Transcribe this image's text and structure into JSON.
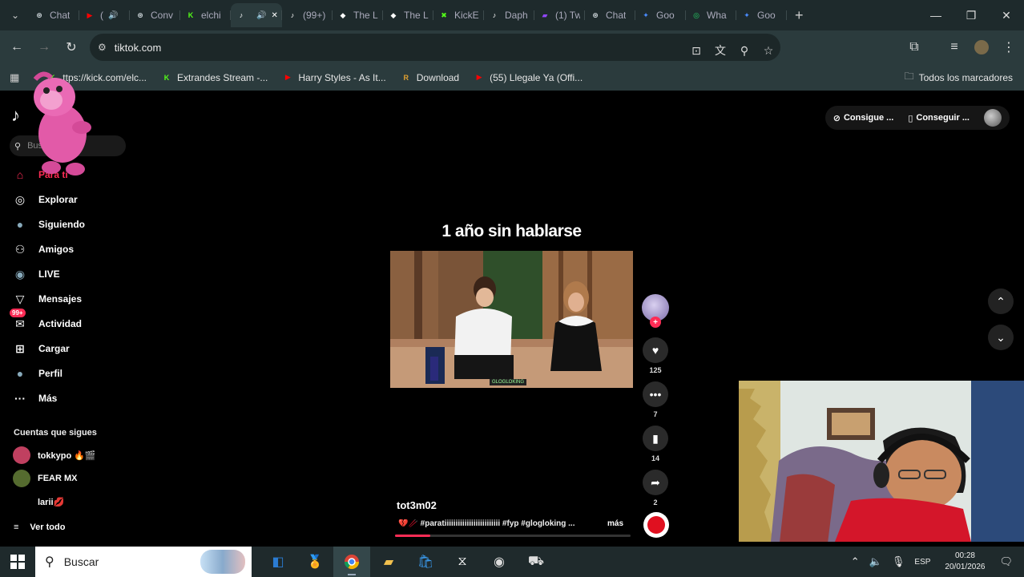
{
  "tabs": [
    {
      "label": "Chat",
      "icon": "chatgpt-icon",
      "color": "#cfd8dc",
      "active": false
    },
    {
      "label": "(",
      "icon": "youtube-icon",
      "color": "#ff0000",
      "active": false,
      "audio": true
    },
    {
      "label": "Conv",
      "icon": "chatgpt-icon",
      "color": "#cfd8dc",
      "active": false
    },
    {
      "label": "elchi",
      "icon": "kick-icon",
      "color": "#53fc18",
      "active": false
    },
    {
      "label": "",
      "icon": "tiktok-icon",
      "color": "#ffffff",
      "active": true,
      "audio": true
    },
    {
      "label": "(99+)",
      "icon": "tiktok-icon",
      "color": "#ffffff",
      "active": false
    },
    {
      "label": "The L",
      "icon": "diamond-icon",
      "color": "#ffffff",
      "active": false
    },
    {
      "label": "The L",
      "icon": "diamond-icon",
      "color": "#ffffff",
      "active": false
    },
    {
      "label": "KickE",
      "icon": "kick-green-icon",
      "color": "#53fc18",
      "active": false
    },
    {
      "label": "Daph",
      "icon": "tiktok-icon",
      "color": "#ffffff",
      "active": false
    },
    {
      "label": "(1) Tw",
      "icon": "twitch-icon",
      "color": "#9146ff",
      "active": false
    },
    {
      "label": "Chat",
      "icon": "chatgpt-icon",
      "color": "#cfd8dc",
      "active": false
    },
    {
      "label": "Goo",
      "icon": "gemini-icon",
      "color": "#4a8cff",
      "active": false
    },
    {
      "label": "Wha",
      "icon": "whatsapp-icon",
      "color": "#25d366",
      "active": false
    },
    {
      "label": "Goo",
      "icon": "gemini-icon",
      "color": "#4a8cff",
      "active": false
    }
  ],
  "address": {
    "url": "tiktok.com"
  },
  "bookmarks": [
    {
      "label": "ttps://kick.com/elc...",
      "icon": "kick-icon",
      "color": "#53fc18"
    },
    {
      "label": "Extrandes Stream -...",
      "icon": "kick-icon",
      "color": "#53fc18"
    },
    {
      "label": "Harry Styles - As It...",
      "icon": "youtube-icon",
      "color": "#ff0000"
    },
    {
      "label": "Download",
      "icon": "r-icon",
      "color": "#e0a030"
    },
    {
      "label": "(55) Llegale Ya (Offi...",
      "icon": "youtube-icon",
      "color": "#ff0000"
    }
  ],
  "bookmarks_all": "Todos los marcadores",
  "sidebar": {
    "search_placeholder": "Bus",
    "nav": [
      {
        "label": "Para ti",
        "icon": "home-icon",
        "active": true
      },
      {
        "label": "Explorar",
        "icon": "compass-icon"
      },
      {
        "label": "Siguiendo",
        "icon": "following-icon"
      },
      {
        "label": "Amigos",
        "icon": "friends-icon"
      },
      {
        "label": "LIVE",
        "icon": "live-icon"
      },
      {
        "label": "Mensajes",
        "icon": "messages-icon"
      },
      {
        "label": "Actividad",
        "icon": "activity-icon",
        "badge": "99+"
      },
      {
        "label": "Cargar",
        "icon": "upload-icon"
      },
      {
        "label": "Perfil",
        "icon": "profile-icon"
      },
      {
        "label": "Más",
        "icon": "more-icon"
      }
    ],
    "following_title": "Cuentas que sigues",
    "following": [
      {
        "name": "tokkypo 🔥🎬",
        "color": "#c04060"
      },
      {
        "name": "FEAR MX",
        "color": "#556b2f"
      },
      {
        "name": "larii💋",
        "color": "#000000"
      }
    ],
    "see_all": "Ver todo"
  },
  "top_right": {
    "coins": "Consigue ...",
    "app": "Conseguir ..."
  },
  "video": {
    "title": "1 año sin hablarse",
    "watermark": "GLOGLOKING",
    "author": "tot3m02",
    "description": "💔🥢 #paratiiiiiiiiiiiiiiiiiiiiiiiii #fyp #glogloking ...",
    "more": "más",
    "progress": 0.15
  },
  "actions": {
    "likes": "125",
    "comments": "7",
    "saves": "14",
    "shares": "2"
  },
  "taskbar": {
    "search": "Buscar",
    "lang": "ESP",
    "time": "00:28",
    "date": "20/01/2026"
  }
}
